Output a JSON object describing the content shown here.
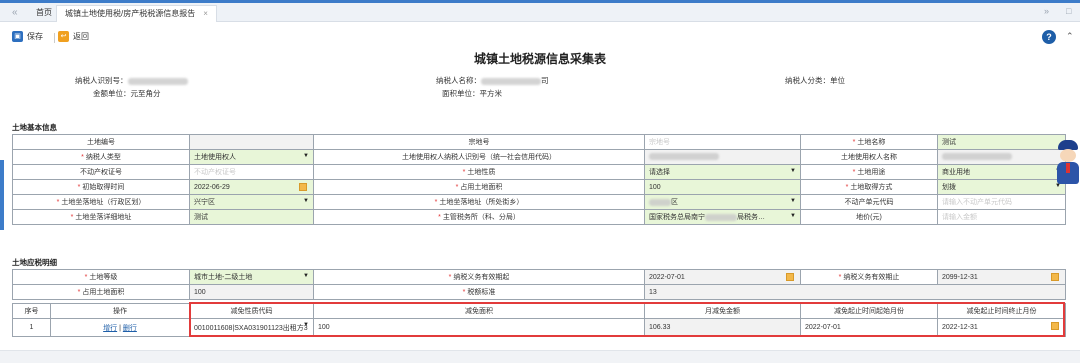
{
  "tabs": {
    "nav_back": "«",
    "home": "首页",
    "active": "城镇土地使用税/房产税税源信息报告",
    "close": "×",
    "nav_forward": "»",
    "minimize": "□"
  },
  "toolbar": {
    "save": "保存",
    "back": "返回"
  },
  "title": "城镇土地税源信息采集表",
  "meta": {
    "taxpayer_id_label": "纳税人识别号：",
    "unit_label": "金额单位：元至角分",
    "taxpayer_name_label": "纳税人名称：",
    "taxpayer_name_tail": "司",
    "area_unit_label": "面积单位：平方米",
    "taxpayer_type_label": "纳税人分类：",
    "taxpayer_type_value": "单位"
  },
  "basic": {
    "section_title": "土地基本信息",
    "row1": [
      "土地编号",
      "",
      "宗地号",
      "宗地号",
      "土地名称",
      "测试"
    ],
    "row2": [
      "纳税人类型",
      "土地使用权人",
      "土地使用权人纳税人识别号（统一社会信用代码）",
      "",
      "土地使用权人名称",
      ""
    ],
    "row3": [
      "不动产权证号",
      "不动产权证号",
      "土地性质",
      "请选择",
      "土地用途",
      "商业用地"
    ],
    "row4": [
      "初始取得时间",
      "2022-06-29",
      "占用土地面积",
      "100",
      "土地取得方式",
      "划拨"
    ],
    "row5": [
      "土地坐落地址（行政区划）",
      "兴宁区",
      "土地坐落地址（所处街乡）",
      "区",
      "不动产单元代码",
      "请输入不动产单元代码"
    ],
    "row6": [
      "土地坐落详细地址",
      "测试",
      "主管税务所（科、分局）",
      "国家税务总局南宁",
      "局税务…",
      "地价(元)",
      "请输入金额"
    ]
  },
  "tax": {
    "section_title": "土地应税明细",
    "row1": [
      "土地等级",
      "城市土地-二级土地",
      "纳税义务有效期起",
      "2022-07-01",
      "纳税义务有效期止",
      "2099-12-31"
    ],
    "row2": [
      "占用土地面积",
      "100",
      "税额标准",
      "13"
    ],
    "header": [
      "序号",
      "操作",
      "减免性质代码",
      "减免面积",
      "月减免金额",
      "减免起止时间起始月份",
      "减免起止时间终止月份"
    ],
    "rows": [
      {
        "no": "1",
        "op_add": "增行",
        "op_sep": "|",
        "op_del": "删行",
        "code": "0010011608|SXA031901123出租方3",
        "area": "100",
        "monthly": "106.33",
        "start": "2022-07-01",
        "end": "2022-12-31"
      }
    ]
  }
}
